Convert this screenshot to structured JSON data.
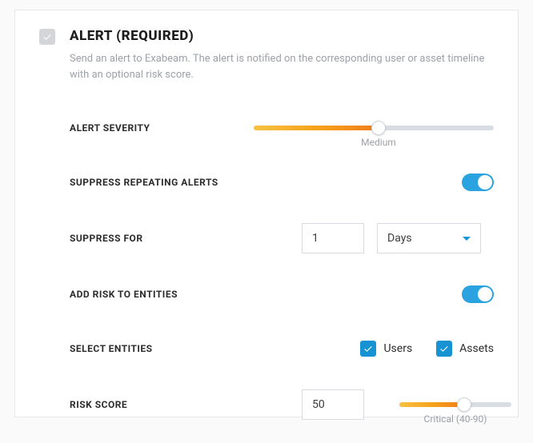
{
  "header": {
    "title": "ALERT (REQUIRED)",
    "description": "Send an alert to Exabeam. The alert is notified on the corresponding user or asset timeline with an optional risk score."
  },
  "rows": {
    "severity": {
      "label": "ALERT SEVERITY",
      "value_pct": 52,
      "value_label": "Medium"
    },
    "suppress_repeating": {
      "label": "SUPPRESS REPEATING ALERTS",
      "on": true
    },
    "suppress_for": {
      "label": "SUPPRESS FOR",
      "value": "1",
      "unit_selected": "Days"
    },
    "add_risk": {
      "label": "ADD RISK TO ENTITIES",
      "on": true
    },
    "select_entities": {
      "label": "SELECT ENTITIES",
      "users": {
        "label": "Users",
        "checked": true
      },
      "assets": {
        "label": "Assets",
        "checked": true
      }
    },
    "risk_score": {
      "label": "RISK SCORE",
      "value": "50",
      "slider_pct": 58,
      "slider_label": "Critical (40-90)"
    }
  }
}
